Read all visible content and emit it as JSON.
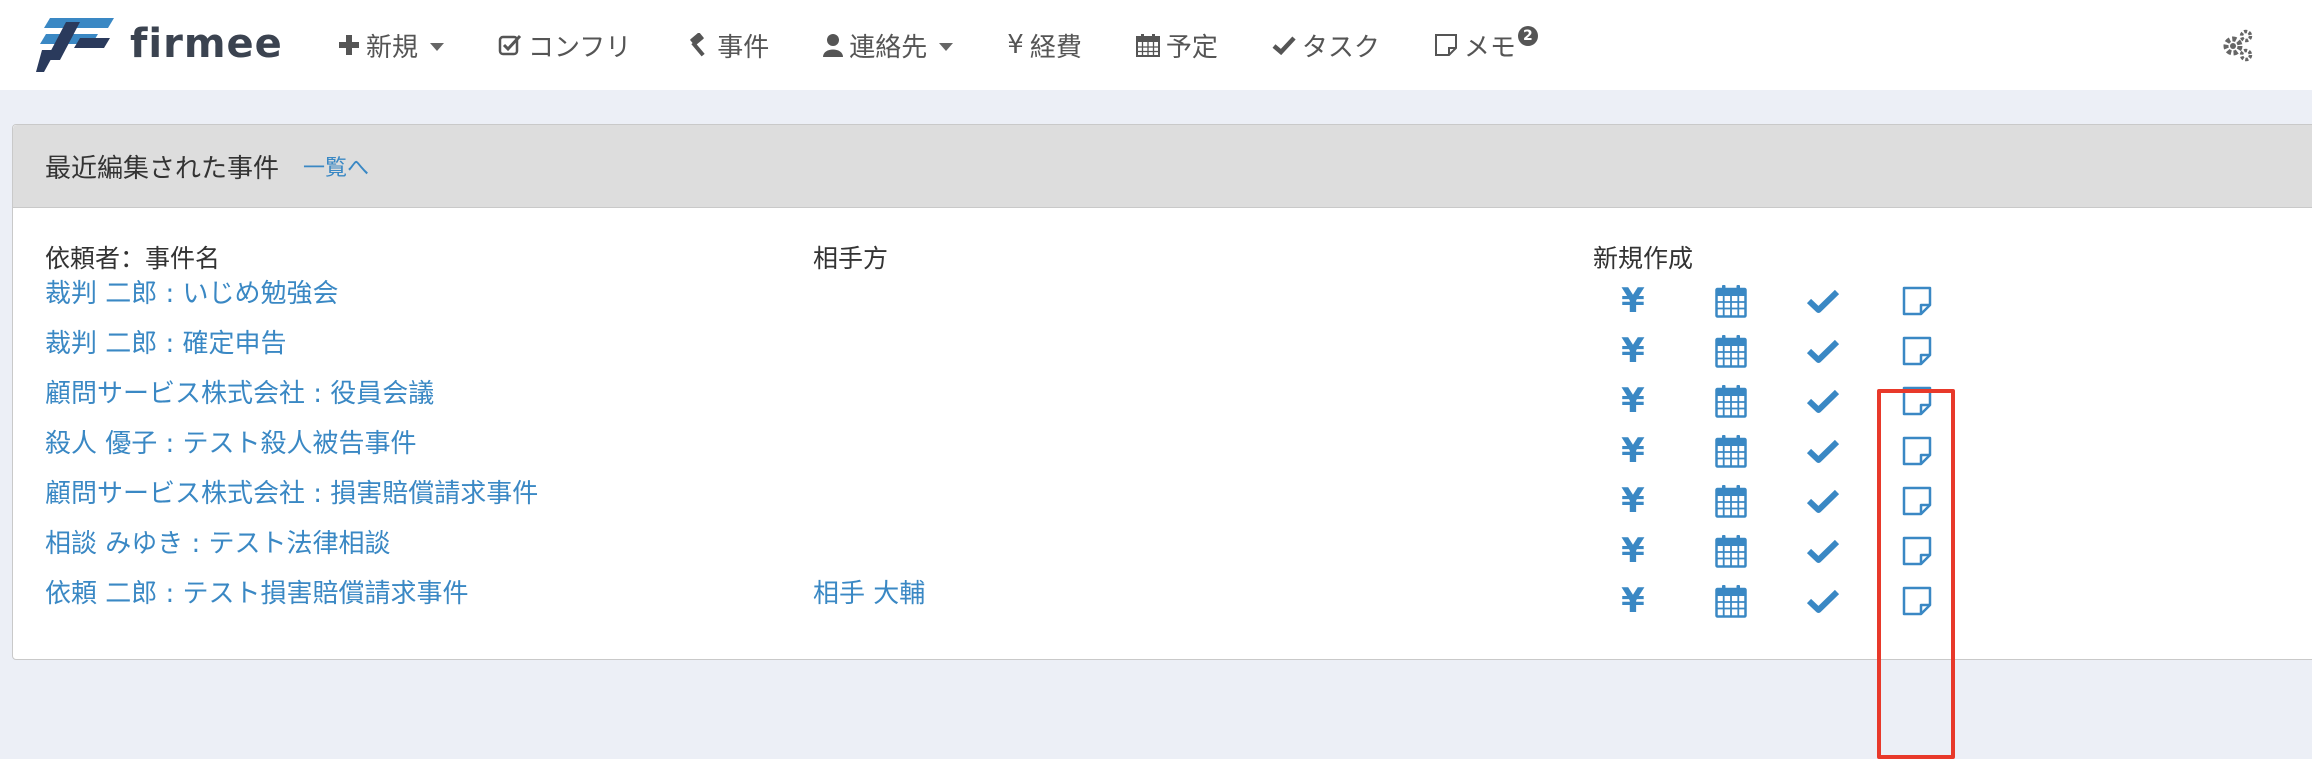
{
  "brand": {
    "name": "firmee",
    "accent": "#3a88c4",
    "dark": "#2a3a5c"
  },
  "nav": {
    "items": [
      {
        "id": "new",
        "icon": "plus-icon",
        "label": "新規",
        "dropdown": true
      },
      {
        "id": "conflict",
        "icon": "checkbox-icon",
        "label": "コンフリ",
        "dropdown": false
      },
      {
        "id": "cases",
        "icon": "gavel-icon",
        "label": "事件",
        "dropdown": false
      },
      {
        "id": "contacts",
        "icon": "user-icon",
        "label": "連絡先",
        "dropdown": true
      },
      {
        "id": "expenses",
        "icon": "yen-icon",
        "label": "経費",
        "dropdown": false
      },
      {
        "id": "schedule",
        "icon": "calendar-icon",
        "label": "予定",
        "dropdown": false
      },
      {
        "id": "tasks",
        "icon": "check-icon",
        "label": "タスク",
        "dropdown": false
      },
      {
        "id": "memo",
        "icon": "memo-icon",
        "label": "メモ",
        "dropdown": false,
        "badge": "2"
      }
    ],
    "settings_icon": "gears-icon"
  },
  "panel": {
    "title": "最近編集された事件",
    "link": "一覧へ",
    "headers": {
      "case": "依頼者：事件名",
      "opponent": "相手方",
      "create": "新規作成"
    },
    "rows": [
      {
        "case": "裁判 二郎 : いじめ勉強会",
        "opponent": ""
      },
      {
        "case": "裁判 二郎 : 確定申告",
        "opponent": ""
      },
      {
        "case": "顧問サービス株式会社 : 役員会議",
        "opponent": ""
      },
      {
        "case": "殺人 優子 : テスト殺人被告事件",
        "opponent": ""
      },
      {
        "case": "顧問サービス株式会社 : 損害賠償請求事件",
        "opponent": ""
      },
      {
        "case": "相談 みゆき : テスト法律相談",
        "opponent": ""
      },
      {
        "case": "依頼 二郎 : テスト損害賠償請求事件",
        "opponent": "相手 大輔"
      }
    ],
    "actions": {
      "yen": "¥"
    },
    "highlight_color": "#e8392a"
  }
}
